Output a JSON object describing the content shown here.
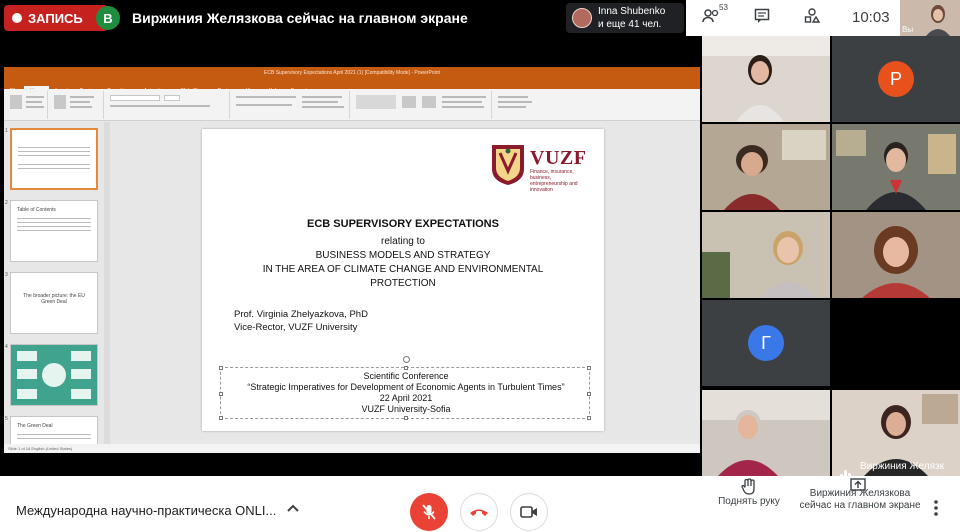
{
  "top_bar": {
    "record_label": "ЗАПИСЬ",
    "presenter_initial": "В",
    "presenter_text": "Виржиния Желязкова сейчас на главном экране",
    "join_notice": {
      "line1": "Inna Shubenko",
      "line2": "и еще 41 чел."
    },
    "participants_count": "53",
    "clock": "10:03",
    "self_label": "Вы"
  },
  "powerpoint": {
    "window_title": "ECB Supervisory Expectations April 2021 (1) [Compatibility Mode] - PowerPoint",
    "tabs": [
      "File",
      "Home",
      "Insert",
      "Design",
      "Transitions",
      "Animations",
      "Slide Show",
      "Review",
      "View",
      "Help",
      "Format"
    ],
    "thumbnails": [
      {
        "num": "1",
        "text": ""
      },
      {
        "num": "2",
        "text": "Table of Contents"
      },
      {
        "num": "3",
        "text": "The broader picture: the EU Green Deal"
      },
      {
        "num": "4",
        "text": ""
      },
      {
        "num": "5",
        "text": "The Green Deal"
      }
    ],
    "status": "Slide 1 of 18    English (United States)",
    "slide": {
      "logo_word": "VUZF",
      "logo_sub": "Finance, insurance, business, entrepreneurship and innovation",
      "title": "ECB SUPERVISORY EXPECTATIONS",
      "line1": "relating to",
      "line2": "BUSINESS MODELS AND STRATEGY",
      "line3": "IN THE AREA OF CLIMATE CHANGE AND ENVIRONMENTAL",
      "line4": "PROTECTION",
      "author1": "Prof. Virginia Zhelyazkova, PhD",
      "author2": "Vice-Rector, VUZF University",
      "conf1": "Scientific Conference",
      "conf2": "“Strategic Imperatives for Development of Economic Agents in Turbulent Times”",
      "conf3": "22 April 2021",
      "conf4": "VUZF University-Sofia"
    }
  },
  "participants": [
    {
      "kind": "video",
      "color": "#d9d3cc"
    },
    {
      "kind": "avatar",
      "initial": "Р",
      "color": "#e8501c"
    },
    {
      "kind": "video",
      "color": "#a89c8c"
    },
    {
      "kind": "video",
      "color": "#6b6f66"
    },
    {
      "kind": "video",
      "color": "#bdb5a8"
    },
    {
      "kind": "video",
      "color": "#8e7a6b"
    },
    {
      "kind": "avatar",
      "initial": "Г",
      "color": "#3b78e7"
    },
    {
      "kind": "video",
      "color": "#000000"
    },
    {
      "kind": "video",
      "color": "#c9c2bc"
    },
    {
      "kind": "video",
      "color": "#d8cdc4",
      "name": "Виржиния Желязк"
    }
  ],
  "bottom_bar": {
    "meeting_name": "Международна научно-практическа ONLI...",
    "raise_hand": "Поднять руку",
    "present_line1": "Виржиния Желязкова",
    "present_line2": "сейчас на главном экране"
  },
  "colors": {
    "record": "#c5221f",
    "powerpoint_accent": "#c55a11",
    "end_call": "#ea4335",
    "vuzf": "#8b1a2b"
  }
}
